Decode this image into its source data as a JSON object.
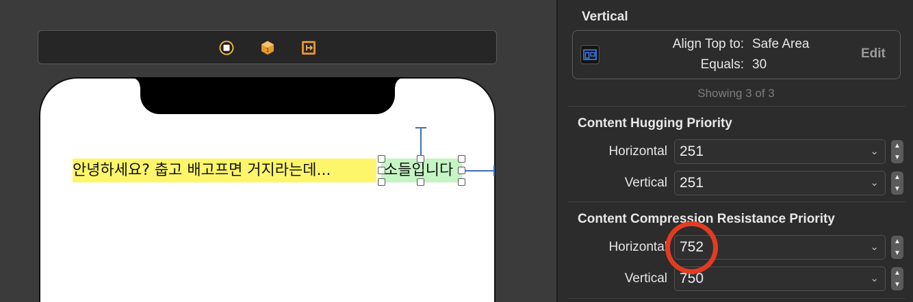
{
  "canvas": {
    "scene_bar_icons": [
      "view-controller-icon",
      "first-responder-icon",
      "exit-icon"
    ],
    "labels": {
      "yellow_label": "안녕하세요? 춥고 배고프면 거지라는데...",
      "green_label": "소들입니다"
    }
  },
  "inspector": {
    "vertical_title": "Vertical",
    "constraint": {
      "key1": "Align Top to:",
      "value1": "Safe Area",
      "key2": "Equals:",
      "value2": "30",
      "edit_label": "Edit",
      "icon": "align-top-icon"
    },
    "showing_text": "Showing 3 of 3",
    "hugging": {
      "title": "Content Hugging Priority",
      "horizontal_label": "Horizontal",
      "horizontal_value": "251",
      "vertical_label": "Vertical",
      "vertical_value": "251"
    },
    "compression": {
      "title": "Content Compression Resistance Priority",
      "horizontal_label": "Horizontal",
      "horizontal_value": "752",
      "vertical_label": "Vertical",
      "vertical_value": "750"
    },
    "colors": {
      "annotation_circle": "#e33b22",
      "yellow_label_bg": "#fef66a",
      "green_label_bg": "#c5f5c5",
      "constraint_line": "#3d6fb3"
    }
  }
}
